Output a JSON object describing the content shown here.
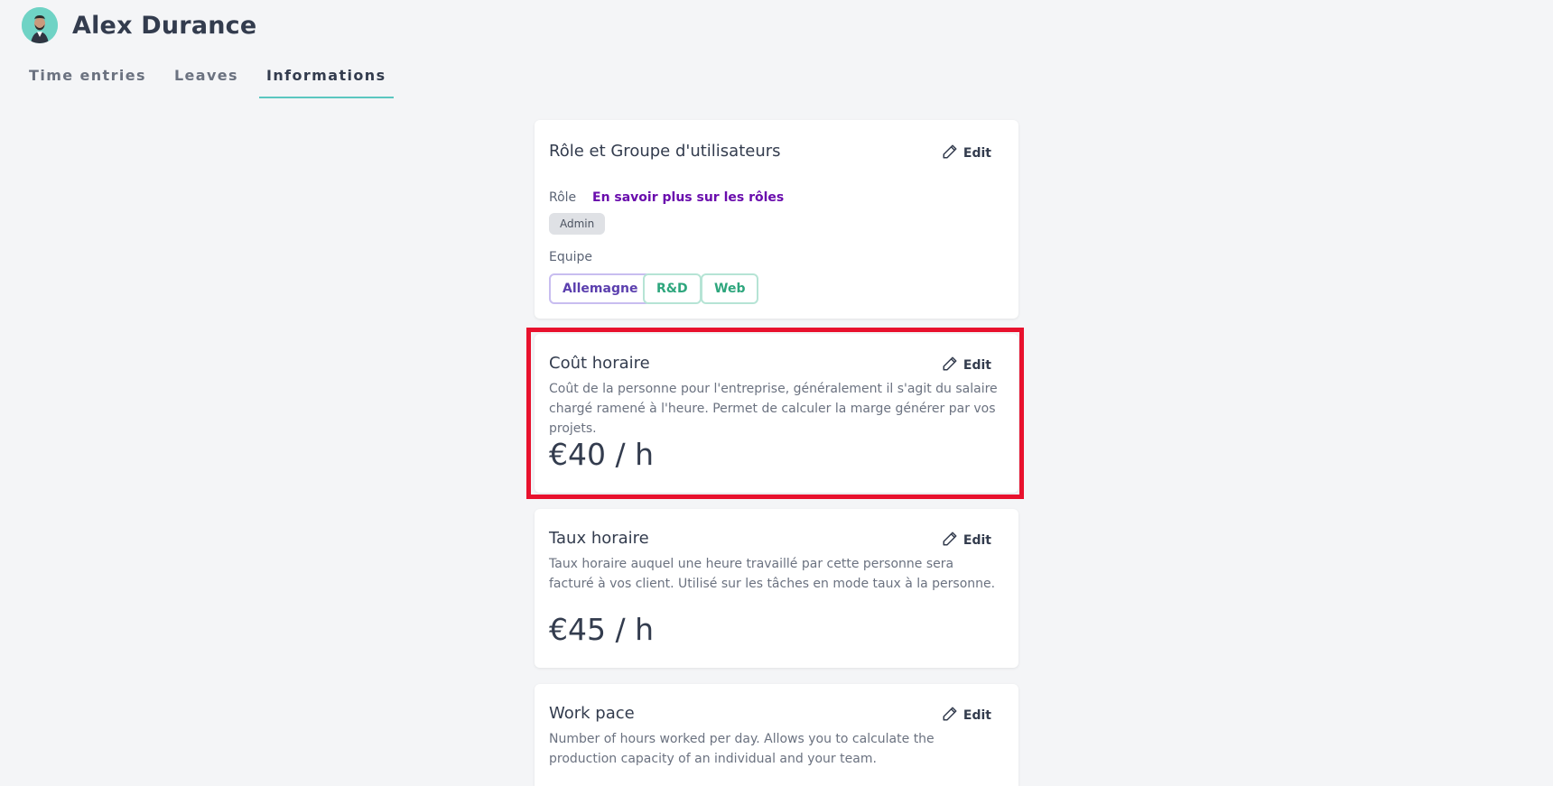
{
  "user": {
    "name": "Alex Durance",
    "avatar": "avatar-photo"
  },
  "tabs": [
    {
      "label": "Time entries",
      "active": false
    },
    {
      "label": "Leaves",
      "active": false
    },
    {
      "label": "Informations",
      "active": true
    }
  ],
  "edit_label": "Edit",
  "role_card": {
    "title": "Rôle et Groupe d'utilisateurs",
    "role_label": "Rôle",
    "role_link": "En savoir plus sur les rôles",
    "role_badge": "Admin",
    "team_label": "Equipe",
    "teams": [
      "Allemagne",
      "R&D",
      "Web"
    ]
  },
  "cost_card": {
    "title": "Coût horaire",
    "description": "Coût de la personne pour l'entreprise, généralement il s'agit du salaire chargé ramené à l'heure. Permet de calculer la marge générer par vos projets.",
    "value": "€40 / h"
  },
  "rate_card": {
    "title": "Taux horaire",
    "description": "Taux horaire auquel une heure travaillé par cette personne sera facturé à vos client. Utilisé sur les tâches en mode taux à la personne.",
    "value": "€45 / h"
  },
  "pace_card": {
    "title": "Work pace",
    "description": "Number of hours worked per day. Allows you to calculate the production capacity of an individual and your team."
  },
  "colors": {
    "accent": "#5bc7c0",
    "highlight": "#e8112d",
    "link": "#6a0dad"
  }
}
